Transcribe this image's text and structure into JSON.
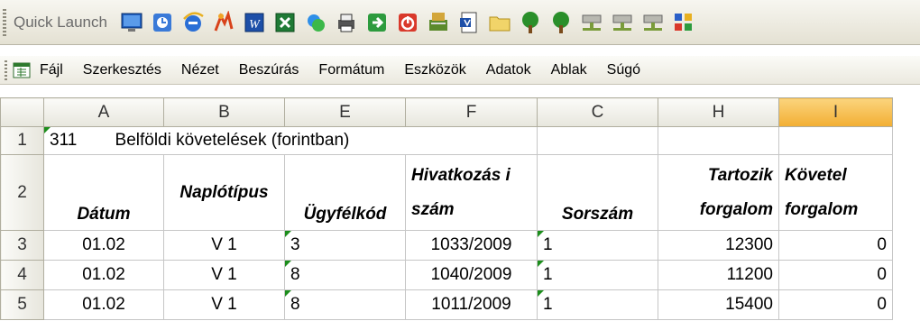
{
  "quick_launch": {
    "label": "Quick Launch",
    "icons": [
      "desktop-icon",
      "windows-update-icon",
      "internet-explorer-icon",
      "winamp-icon",
      "word-icon",
      "excel-icon",
      "messenger-icon",
      "printer-icon",
      "exit-icon",
      "shutdown-icon",
      "server-gis-icon",
      "word-doc-icon",
      "folder-icon",
      "tree-icon",
      "tree-icon",
      "network-drive-icon",
      "network-drive-icon",
      "network-drive-icon",
      "network-chart-icon"
    ]
  },
  "menu": {
    "items": [
      "Fájl",
      "Szerkesztés",
      "Nézet",
      "Beszúrás",
      "Formátum",
      "Eszközök",
      "Adatok",
      "Ablak",
      "Súgó"
    ]
  },
  "grid": {
    "corner": "",
    "columns": [
      "A",
      "B",
      "E",
      "F",
      "C",
      "H",
      "I"
    ],
    "rows": [
      {
        "num": "1",
        "title": "311",
        "subtitle": "Belföldi követelések (forintban)"
      },
      {
        "num": "2",
        "cells": [
          "Dátum",
          "Naplótípus",
          "Ügyfélkód",
          "Hivatkozás i szám",
          "Sorszám",
          "Tartozik forgalom",
          "Követel forgalom"
        ]
      },
      {
        "num": "3",
        "cells": [
          "01.02",
          "V 1",
          "3",
          "1033/2009",
          "1",
          "12300",
          "0"
        ]
      },
      {
        "num": "4",
        "cells": [
          "01.02",
          "V 1",
          "8",
          "1040/2009",
          "1",
          "11200",
          "0"
        ]
      },
      {
        "num": "5",
        "cells": [
          "01.02",
          "V 1",
          "8",
          "1011/2009",
          "1",
          "15400",
          "0"
        ]
      }
    ]
  }
}
